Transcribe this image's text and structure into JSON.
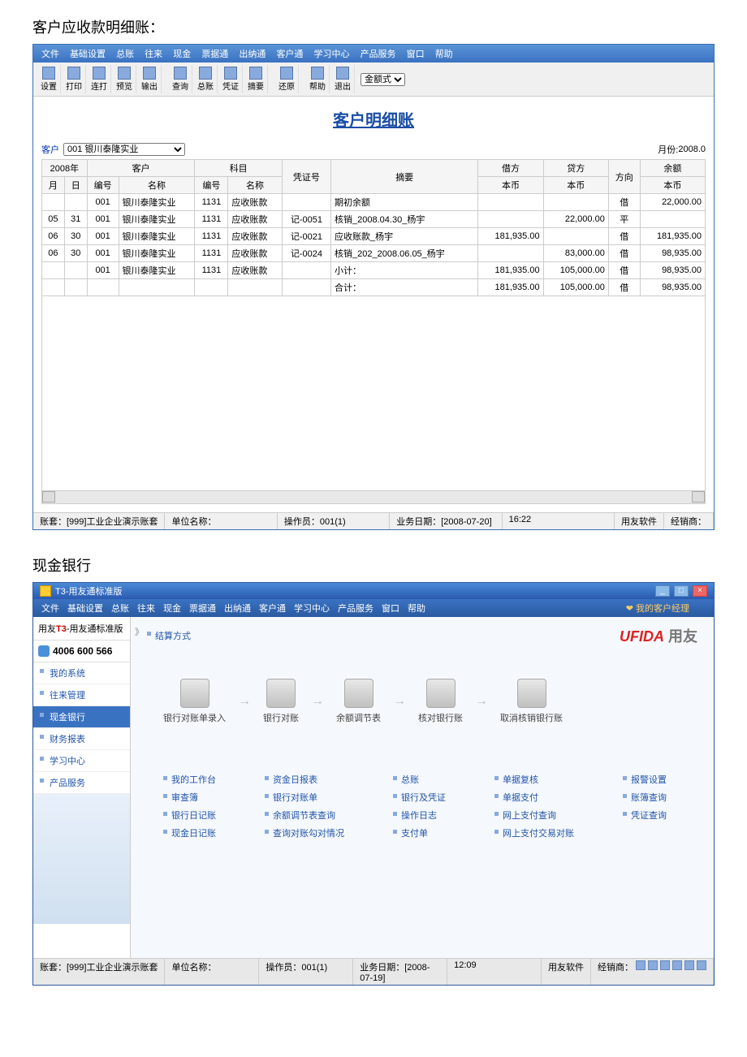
{
  "titles": {
    "section1": "客户应收款明细账：",
    "section2": "现金银行",
    "doc_title": "客户明细账"
  },
  "menu1": [
    "文件",
    "基础设置",
    "总账",
    "往来",
    "现金",
    "票据通",
    "出纳通",
    "客户通",
    "学习中心",
    "产品服务",
    "窗口",
    "帮助"
  ],
  "toolbar1": {
    "buttons": [
      "设置",
      "打印",
      "连打",
      "预览",
      "输出",
      "查询",
      "总账",
      "凭证",
      "摘要",
      "还原",
      "帮助",
      "退出"
    ],
    "mode_select": "金额式"
  },
  "filter": {
    "customer_label": "客户",
    "customer_value": "001  银川泰隆实业",
    "month_label": "月份:",
    "month_value": "2008.0"
  },
  "table": {
    "header_group": {
      "year": "2008年",
      "customer": "客户",
      "subject": "科目",
      "voucher": "凭证号",
      "summary": "摘要",
      "debit": "借方",
      "credit": "贷方",
      "direction": "方向",
      "balance": "余额"
    },
    "sub_header": {
      "month": "月",
      "day": "日",
      "code": "编号",
      "name": "名称",
      "code2": "编号",
      "name2": "名称",
      "local1": "本币",
      "local2": "本币",
      "local3": "本币"
    },
    "rows": [
      {
        "month": "",
        "day": "",
        "code": "001",
        "name": "银川泰隆实业",
        "code2": "1131",
        "name2": "应收账款",
        "voucher": "",
        "summary": "期初余额",
        "debit": "",
        "credit": "",
        "dir": "借",
        "balance": "22,000.00"
      },
      {
        "month": "05",
        "day": "31",
        "code": "001",
        "name": "银川泰隆实业",
        "code2": "1131",
        "name2": "应收账款",
        "voucher": "记-0051",
        "summary": "核销_2008.04.30_杨宇",
        "debit": "",
        "credit": "22,000.00",
        "dir": "平",
        "balance": ""
      },
      {
        "month": "06",
        "day": "30",
        "code": "001",
        "name": "银川泰隆实业",
        "code2": "1131",
        "name2": "应收账款",
        "voucher": "记-0021",
        "summary": "应收账款_杨宇",
        "debit": "181,935.00",
        "credit": "",
        "dir": "借",
        "balance": "181,935.00"
      },
      {
        "month": "06",
        "day": "30",
        "code": "001",
        "name": "银川泰隆实业",
        "code2": "1131",
        "name2": "应收账款",
        "voucher": "记-0024",
        "summary": "核销_202_2008.06.05_杨宇",
        "debit": "",
        "credit": "83,000.00",
        "dir": "借",
        "balance": "98,935.00"
      },
      {
        "month": "",
        "day": "",
        "code": "001",
        "name": "银川泰隆实业",
        "code2": "1131",
        "name2": "应收账款",
        "voucher": "",
        "summary": "小计：",
        "debit": "181,935.00",
        "credit": "105,000.00",
        "dir": "借",
        "balance": "98,935.00"
      },
      {
        "month": "",
        "day": "",
        "code": "",
        "name": "",
        "code2": "",
        "name2": "",
        "voucher": "",
        "summary": "合计：",
        "debit": "181,935.00",
        "credit": "105,000.00",
        "dir": "借",
        "balance": "98,935.00"
      }
    ]
  },
  "status1": {
    "account": "账套：[999]工业企业演示账套",
    "unit_label": "单位名称：",
    "operator": "操作员：001(1)",
    "bizdate": "业务日期：[2008-07-20]",
    "time": "16:22",
    "software": "用友软件",
    "dealer_label": "经销商："
  },
  "win2": {
    "title": "T3-用友通标准版",
    "right_link": "我的客户经理"
  },
  "menu2": [
    "文件",
    "基础设置",
    "总账",
    "往来",
    "现金",
    "票据通",
    "出纳通",
    "客户通",
    "学习中心",
    "产品服务",
    "窗口",
    "帮助"
  ],
  "sidebar": {
    "brand_prefix": "用友",
    "brand_t3": "T3",
    "brand_suffix": "-用友通标准版",
    "phone": "4006 600 566",
    "nav": [
      {
        "label": "我的系统",
        "active": false
      },
      {
        "label": "往来管理",
        "active": false
      },
      {
        "label": "现金银行",
        "active": true
      },
      {
        "label": "财务报表",
        "active": false
      },
      {
        "label": "学习中心",
        "active": false
      },
      {
        "label": "产品服务",
        "active": false
      }
    ]
  },
  "main2": {
    "top_link": "结算方式",
    "logo_red": "UFIDA",
    "logo_grey": "用友",
    "workflow": [
      "银行对账单录入",
      "银行对账",
      "余额调节表",
      "核对银行账",
      "取消核销银行账"
    ],
    "link_cols": [
      [
        "我的工作台",
        "审查簿",
        "银行日记账",
        "现金日记账"
      ],
      [
        "资金日报表",
        "银行对账单",
        "余额调节表查询",
        "查询对账勾对情况"
      ],
      [
        "总账",
        "银行及凭证",
        "操作日志",
        "支付单"
      ],
      [
        "单据复核",
        "单据支付",
        "网上支付查询",
        "网上支付交易对账"
      ],
      [
        "报警设置",
        "账簿查询",
        "凭证查询"
      ]
    ]
  },
  "status2": {
    "account": "账套：[999]工业企业演示账套",
    "unit_label": "单位名称：",
    "operator": "操作员：001(1)",
    "bizdate": "业务日期：[2008-07-19]",
    "time": "12:09",
    "software": "用友软件",
    "dealer_label": "经销商："
  }
}
